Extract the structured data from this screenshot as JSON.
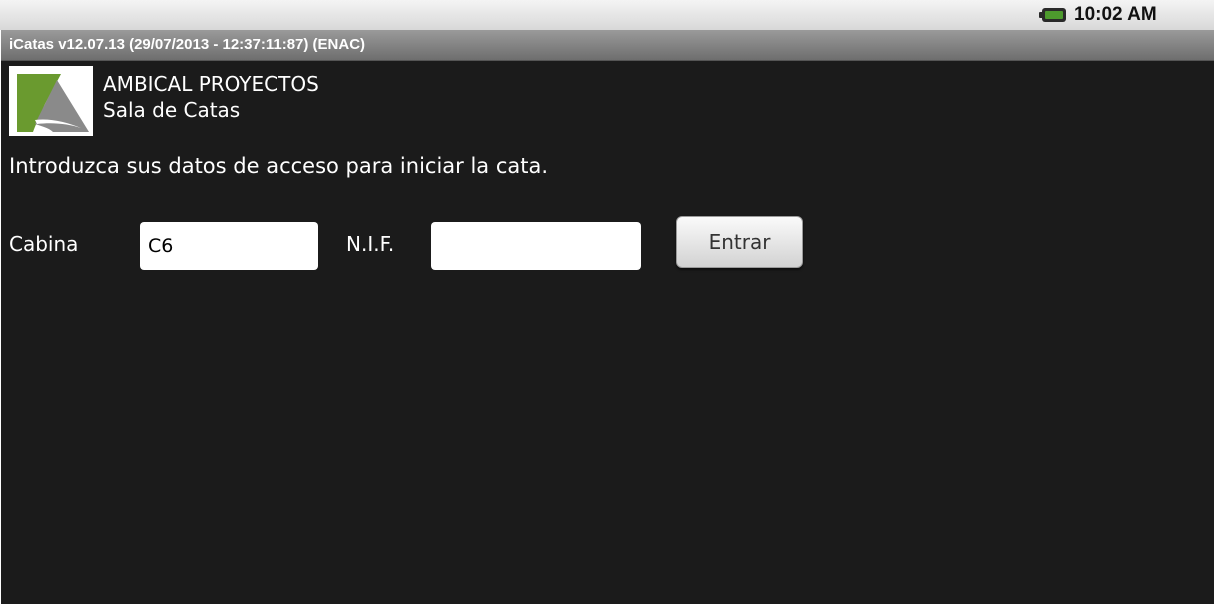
{
  "status_bar": {
    "time": "10:02 AM",
    "icons": [
      "battery-charging-icon"
    ]
  },
  "window": {
    "title": "iCatas v12.07.13 (29/07/2013 - 12:37:11:87) (ENAC)"
  },
  "header": {
    "logo": "ambical-logo",
    "company": "AMBICAL PROYECTOS",
    "subtitle": "Sala de Catas"
  },
  "login": {
    "instructions": "Introduzca sus datos de acceso para iniciar la cata.",
    "cabina_label": "Cabina",
    "cabina_value": "C6",
    "nif_label": "N.I.F.",
    "nif_value": "",
    "enter_label": "Entrar"
  },
  "colors": {
    "background": "#1b1b1b",
    "title_bar": "#7d7d7d",
    "logo_green": "#6a9a2f",
    "logo_gray": "#8a8a8a"
  }
}
